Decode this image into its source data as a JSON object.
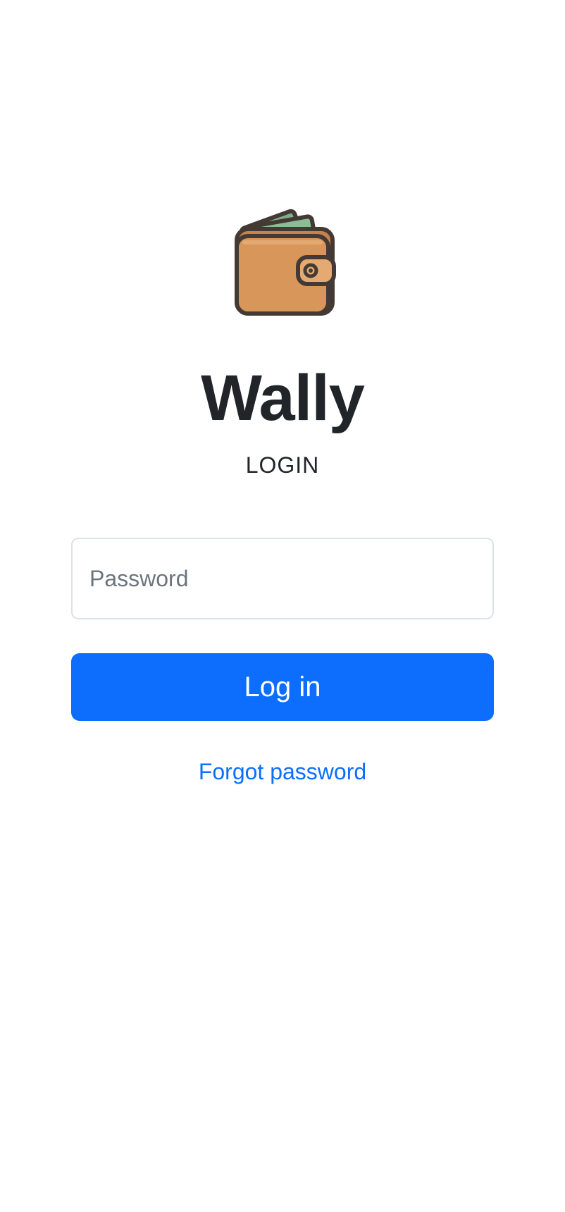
{
  "app": {
    "title": "Wally",
    "subtitle": "LOGIN",
    "logo_icon": "wallet-icon"
  },
  "form": {
    "password": {
      "value": "",
      "placeholder": "Password"
    },
    "login_button_label": "Log in",
    "forgot_password_label": "Forgot password"
  },
  "colors": {
    "primary": "#0d6efd",
    "text": "#212529",
    "placeholder": "#6c757d",
    "input_border": "#dee2e6",
    "background": "#ffffff",
    "wallet_body": "#d9965a",
    "wallet_outline": "#433a36",
    "banknote": "#7fb08a"
  }
}
